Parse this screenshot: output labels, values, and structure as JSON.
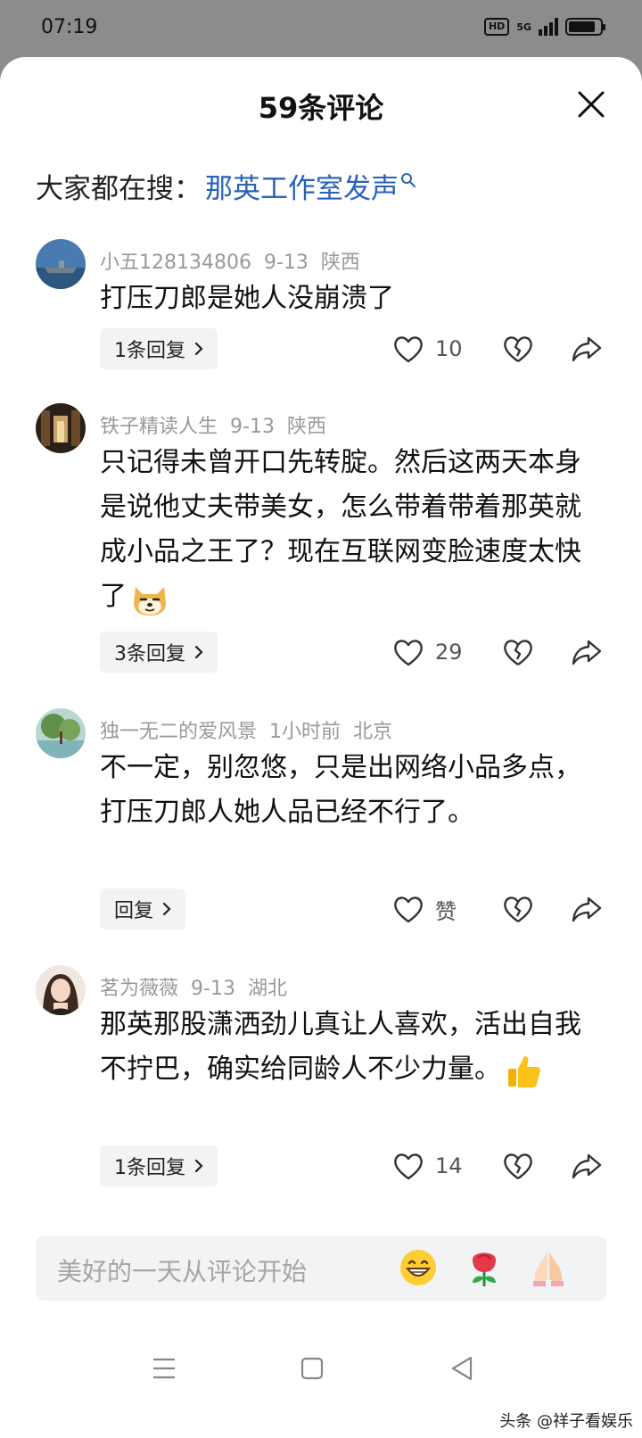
{
  "status_bar": {
    "time": "07:19",
    "hd": "HD",
    "network": "5G",
    "battery_level": 0.85
  },
  "header": {
    "title": "59条评论"
  },
  "search_hint": {
    "prefix": "大家都在搜：",
    "query": "那英工作室发声"
  },
  "comments": [
    {
      "username": "小五128134806",
      "date": "9-13",
      "location": "陕西",
      "text": "打压刀郎是她人没崩溃了",
      "emoji": "",
      "reply_label": "1条回复",
      "likes": "10"
    },
    {
      "username": "铁子精读人生",
      "date": "9-13",
      "location": "陕西",
      "text": "只记得未曾开口先转腚。然后这两天本身是说他丈夫带美女，怎么带着带着那英就成小品之王了？现在互联网变脸速度太快了",
      "emoji": "doge-face-icon",
      "reply_label": "3条回复",
      "likes": "29"
    },
    {
      "username": "独一无二的爱风景",
      "date": "1小时前",
      "location": "北京",
      "text": "不一定，别忽悠，只是出网络小品多点，打压刀郎人她人品已经不行了。",
      "emoji": "",
      "reply_label": "回复",
      "likes": "赞"
    },
    {
      "username": "茗为薇薇",
      "date": "9-13",
      "location": "湖北",
      "text": "那英那股潇洒劲儿真让人喜欢，活出自我不拧巴，确实给同龄人不少力量。",
      "emoji": "thumbs-up-icon",
      "reply_label": "1条回复",
      "likes": "14"
    }
  ],
  "input": {
    "placeholder": "美好的一天从评论开始"
  },
  "quick_emojis": [
    "grinning-face-icon",
    "rose-icon",
    "folded-hands-icon"
  ],
  "watermark": "头条 @祥子看娱乐",
  "colors": {
    "link": "#2a62b8",
    "meta": "#999999",
    "reply_bg": "#f2f3f5"
  }
}
